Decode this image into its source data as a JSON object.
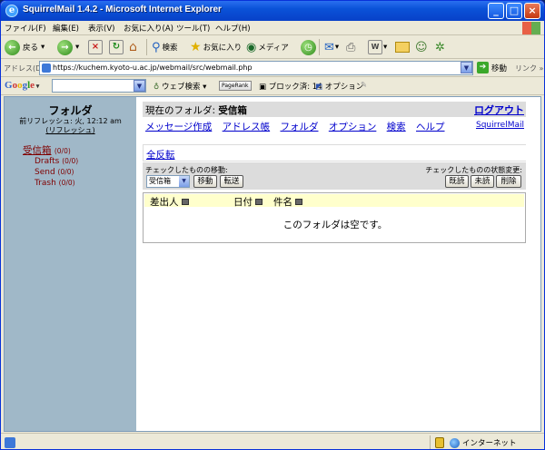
{
  "window": {
    "title": "SquirrelMail 1.4.2 - Microsoft Internet Explorer",
    "icon": "ie-icon"
  },
  "menu": [
    "ファイル(F)",
    "編集(E)",
    "表示(V)",
    "お気に入り(A)",
    "ツール(T)",
    "ヘルプ(H)"
  ],
  "toolbar": {
    "back": "戻る",
    "search": "検索",
    "favorites": "お気に入り",
    "media": "メディア"
  },
  "address": {
    "label": "アドレス(D)",
    "url": "https://kuchem.kyoto-u.ac.jp/webmail/src/webmail.php",
    "go": "移動",
    "links": "リンク »"
  },
  "google": {
    "logo": "Google",
    "web_search": "ウェブ検索",
    "pagerank": "PageRank",
    "blocked": "ブロック済: 14",
    "options": "オプション"
  },
  "sidebar": {
    "heading": "フォルダ",
    "last_refresh": "前リフレッシュ: 火, 12:12 am",
    "refresh_link": "(リフレッシュ)",
    "folders": [
      {
        "name": "受信箱",
        "count": "(0/0)"
      },
      {
        "name": "Drafts",
        "count": "(0/0)"
      },
      {
        "name": "Send",
        "count": "(0/0)"
      },
      {
        "name": "Trash",
        "count": "(0/0)"
      }
    ]
  },
  "main": {
    "current_folder_label": "現在のフォルダ:",
    "current_folder": "受信箱",
    "logout": "ログアウト",
    "nav": [
      "メッセージ作成",
      "アドレス帳",
      "フォルダ",
      "オプション",
      "検索",
      "ヘルプ"
    ],
    "squirrelmail_link": "SquirrelMail",
    "toggle_all": "全反転",
    "move_label": "チェックしたものの移動:",
    "move_select": "受信箱",
    "move_button": "移動",
    "forward_button": "転送",
    "status_label": "チェックしたものの状態変更:",
    "read_button": "既読",
    "unread_button": "未読",
    "delete_button": "削除",
    "columns": {
      "from": "差出人",
      "date": "日付",
      "subject": "件名"
    },
    "empty_message": "このフォルダは空です。"
  },
  "statusbar": {
    "zone": "インターネット"
  }
}
